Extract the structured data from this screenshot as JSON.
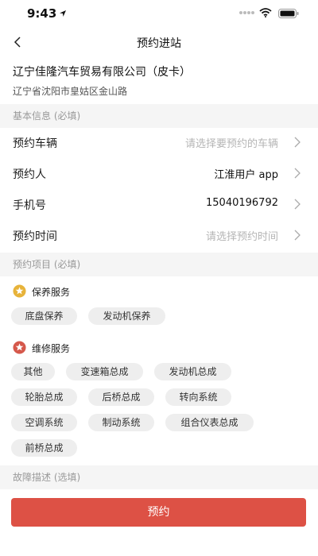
{
  "status_bar": {
    "time": "9:43"
  },
  "nav": {
    "title": "预约进站"
  },
  "company": {
    "name": "辽宁佳隆汽车贸易有限公司（皮卡）",
    "address": "辽宁省沈阳市皇姑区金山路"
  },
  "basic_info": {
    "header": "基本信息 (必填)",
    "vehicle": {
      "label": "预约车辆",
      "placeholder": "请选择要预约的车辆"
    },
    "person": {
      "label": "预约人",
      "value": "江淮用户 app"
    },
    "phone": {
      "label": "手机号",
      "value": "15040196792"
    },
    "time": {
      "label": "预约时间",
      "placeholder": "请选择预约时间"
    }
  },
  "service_items": {
    "header": "预约项目 (必填)",
    "maintenance": {
      "label": "保养服务",
      "icon": "star-icon",
      "color": "#e7b33a",
      "tags": [
        "底盘保养",
        "发动机保养"
      ]
    },
    "repair": {
      "label": "维修服务",
      "icon": "star-icon",
      "color": "#d5584b",
      "tags": [
        "其他",
        "变速箱总成",
        "发动机总成",
        "轮胎总成",
        "后桥总成",
        "转向系统",
        "空调系统",
        "制动系统",
        "组合仪表总成",
        "前桥总成"
      ]
    }
  },
  "fault": {
    "header": "故障描述 (选填)"
  },
  "submit_label": "预约",
  "colors": {
    "accent": "#dd5145",
    "section_bg": "#f5f5f5",
    "tag_bg": "#eeeeee",
    "placeholder": "#b5b5b5"
  }
}
